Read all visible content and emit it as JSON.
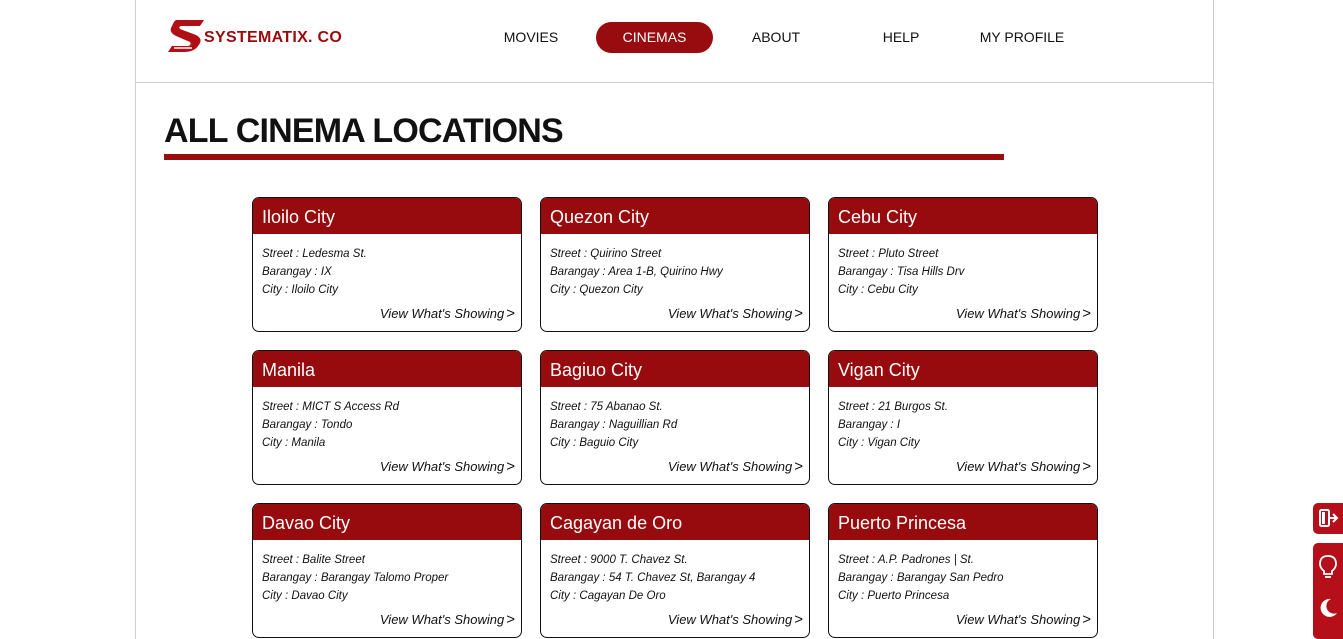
{
  "brand": {
    "name": "SYSTEMATIX. CO",
    "accent": "#980b0e"
  },
  "nav": {
    "items": [
      {
        "label": "MOVIES",
        "active": false
      },
      {
        "label": "CINEMAS",
        "active": true
      },
      {
        "label": "ABOUT",
        "active": false
      },
      {
        "label": "HELP",
        "active": false
      },
      {
        "label": "MY PROFILE",
        "active": false
      }
    ]
  },
  "page": {
    "title": "ALL CINEMA LOCATIONS"
  },
  "cinemas": [
    {
      "name": "Iloilo City",
      "street": "Street : Ledesma St.",
      "barangay": "Barangay : IX",
      "city": "City : Iloilo City",
      "link": "View What's Showing"
    },
    {
      "name": "Quezon City",
      "street": "Street : Quirino Street",
      "barangay": "Barangay : Area 1-B, Quirino Hwy",
      "city": "City : Quezon City",
      "link": "View What's Showing"
    },
    {
      "name": "Cebu City",
      "street": "Street : Pluto Street",
      "barangay": "Barangay : Tisa Hills Drv",
      "city": "City : Cebu City",
      "link": "View What's Showing"
    },
    {
      "name": "Manila",
      "street": "Street : MICT S Access Rd",
      "barangay": "Barangay : Tondo",
      "city": "City : Manila",
      "link": "View What's Showing"
    },
    {
      "name": "Bagiuo City",
      "street": "Street : 75 Abanao St.",
      "barangay": "Barangay : Naguillian Rd",
      "city": "City : Baguio City",
      "link": "View What's Showing"
    },
    {
      "name": "Vigan City",
      "street": "Street : 21 Burgos St.",
      "barangay": "Barangay : I",
      "city": "City : Vigan City",
      "link": "View What's Showing"
    },
    {
      "name": "Davao City",
      "street": "Street : Balite Street",
      "barangay": "Barangay : Barangay Talomo Proper",
      "city": "City : Davao City",
      "link": "View What's Showing"
    },
    {
      "name": "Cagayan de Oro",
      "street": "Street : 9000 T. Chavez St.",
      "barangay": "Barangay : 54 T. Chavez St, Barangay 4",
      "city": "City : Cagayan De Oro",
      "link": "View What's Showing"
    },
    {
      "name": "Puerto Princesa",
      "street": "Street : A.P. Padrones | St.",
      "barangay": "Barangay : Barangay San Pedro",
      "city": "City : Puerto Princesa",
      "link": "View What's Showing"
    }
  ],
  "side_controls": [
    {
      "icon": "logout-icon"
    },
    {
      "icon": "lightbulb-icon"
    },
    {
      "icon": "moon-icon"
    }
  ]
}
